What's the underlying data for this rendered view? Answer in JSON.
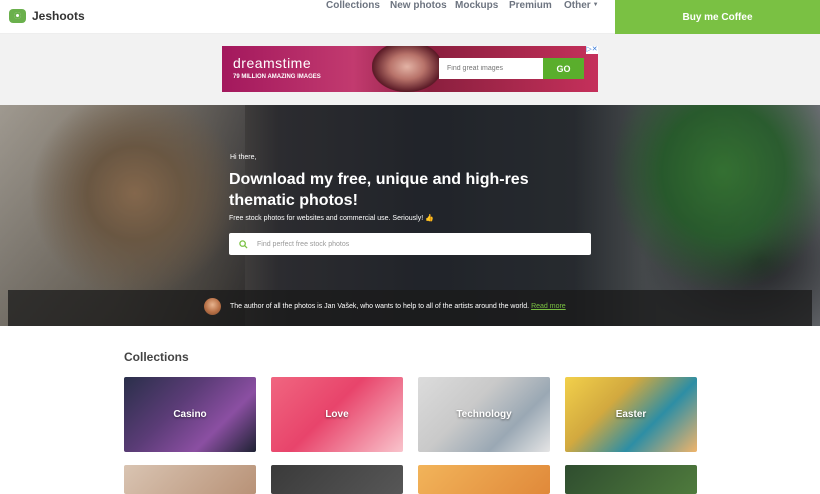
{
  "header": {
    "logo_text": "Jeshoots",
    "nav": [
      {
        "label": "Collections"
      },
      {
        "label": "New photos"
      },
      {
        "label": "Mockups"
      },
      {
        "label": "Premium"
      },
      {
        "label": "Other"
      }
    ],
    "cta_label": "Buy me Coffee"
  },
  "ad": {
    "brand": "dreamstime",
    "sub": "79 MILLION AMAZING IMAGES",
    "placeholder": "Find great images",
    "go_label": "GO"
  },
  "hero": {
    "greeting": "Hi there,",
    "headline": "Download my free, unique and high-res thematic photos!",
    "tagline": "Free stock photos for websites and commercial use. Seriously! 👍",
    "search_placeholder": "Find perfect free stock photos",
    "author_text": "The author of all the photos is Jan Vašek, who wants to help to all of the artists around the world.",
    "author_link": "Read more"
  },
  "collections": {
    "title": "Collections",
    "items": [
      {
        "label": "Casino"
      },
      {
        "label": "Love"
      },
      {
        "label": "Technology"
      },
      {
        "label": "Easter"
      }
    ]
  },
  "colors": {
    "accent": "#7ac143",
    "nav_text": "#6d7480"
  }
}
